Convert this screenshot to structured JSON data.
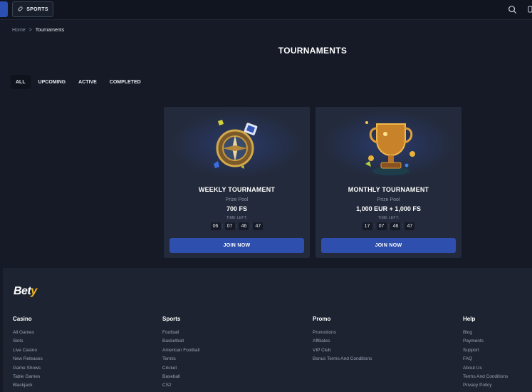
{
  "header": {
    "sports_label": "SPORTS"
  },
  "breadcrumb": {
    "home": "Home",
    "separator": ">",
    "current": "Tournaments"
  },
  "page_title": "TOURNAMENTS",
  "tabs": [
    "ALL",
    "UPCOMING",
    "ACTIVE",
    "COMPLETED"
  ],
  "cards": [
    {
      "name": "WEEKLY TOURNAMENT",
      "prize_label": "Prize Pool",
      "prize_value": "700 FS",
      "time_label": "TIME LEFT:",
      "timer": [
        "06",
        "07",
        "46",
        "47"
      ],
      "join_label": "JOIN NOW",
      "art_icon": "compass-icon"
    },
    {
      "name": "MONTHLY TOURNAMENT",
      "prize_label": "Prize Pool",
      "prize_value": "1,000 EUR + 1,000 FS",
      "time_label": "TIME LEFT:",
      "timer": [
        "17",
        "07",
        "46",
        "47"
      ],
      "join_label": "JOIN NOW",
      "art_icon": "trophy-icon"
    }
  ],
  "footer": {
    "logo_main": "Bet",
    "logo_accent": "y",
    "columns": [
      {
        "title": "Casino",
        "links": [
          "All Games",
          "Slots",
          "Live Casino",
          "New Releases",
          "Game Shows",
          "Table Games",
          "Blackjack"
        ]
      },
      {
        "title": "Sports",
        "links": [
          "Football",
          "Basketball",
          "American Football",
          "Tennis",
          "Cricket",
          "Baseball",
          "CS2"
        ]
      },
      {
        "title": "Promo",
        "links": [
          "Promotions",
          "Affiliates",
          "VIP Club",
          "Bonus Terms And Conditions"
        ]
      },
      {
        "title": "Help",
        "links": [
          "Blog",
          "Payments",
          "Support",
          "FAQ",
          "About Us",
          "Terms And Conditions",
          "Privacy Policy"
        ]
      }
    ]
  },
  "colors": {
    "background": "#151a26",
    "card": "#232a3b",
    "accent_button": "#2f4fae",
    "logo_accent": "#f4b91f"
  }
}
